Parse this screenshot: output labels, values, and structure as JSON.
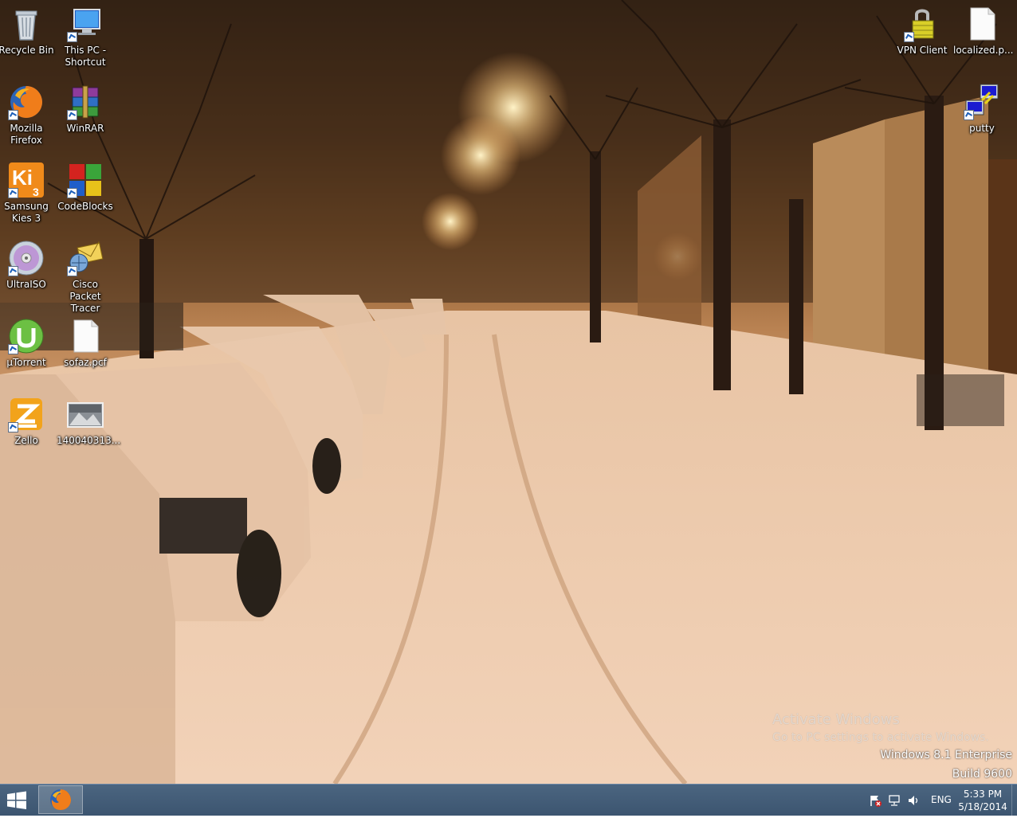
{
  "desktop": {
    "icons": [
      {
        "label_line1": "Recycle Bin",
        "label_line2": "",
        "icon": "recycle-bin-icon"
      },
      {
        "label_line1": "This PC -",
        "label_line2": "Shortcut",
        "icon": "computer-icon"
      },
      {
        "label_line1": "Mozilla",
        "label_line2": "Firefox",
        "icon": "firefox-icon"
      },
      {
        "label_line1": "WinRAR",
        "label_line2": "",
        "icon": "winrar-icon"
      },
      {
        "label_line1": "Samsung",
        "label_line2": "Kies 3",
        "icon": "kies-icon"
      },
      {
        "label_line1": "CodeBlocks",
        "label_line2": "",
        "icon": "codeblocks-icon"
      },
      {
        "label_line1": "UltraISO",
        "label_line2": "",
        "icon": "ultraiso-icon"
      },
      {
        "label_line1": "Cisco Packet",
        "label_line2": "Tracer",
        "icon": "packet-tracer-icon"
      },
      {
        "label_line1": "µTorrent",
        "label_line2": "",
        "icon": "utorrent-icon"
      },
      {
        "label_line1": "sofaz.pcf",
        "label_line2": "",
        "icon": "file-icon"
      },
      {
        "label_line1": "Zello",
        "label_line2": "",
        "icon": "zello-icon"
      },
      {
        "label_line1": "140040313...",
        "label_line2": "",
        "icon": "image-file-icon"
      },
      {
        "label_line1": "VPN Client",
        "label_line2": "",
        "icon": "vpn-lock-icon"
      },
      {
        "label_line1": "localized.p...",
        "label_line2": "",
        "icon": "file-icon"
      },
      {
        "label_line1": "putty",
        "label_line2": "",
        "icon": "putty-icon"
      }
    ]
  },
  "watermark": {
    "title": "Activate Windows",
    "subtitle": "Go to PC settings to activate Windows.",
    "edition": "Windows 8.1 Enterprise",
    "build": "Build 9600"
  },
  "taskbar": {
    "start_icon": "windows-logo-icon",
    "pinned": [
      {
        "name": "Mozilla Firefox",
        "icon": "firefox-icon"
      }
    ],
    "tray": {
      "icons": [
        "action-center-flag-icon",
        "network-icon",
        "volume-icon"
      ],
      "language": "ENG",
      "time": "5:33 PM",
      "date": "5/18/2014"
    }
  },
  "colors": {
    "taskbar": "#3f5874",
    "accent": "#1d5fb8"
  }
}
